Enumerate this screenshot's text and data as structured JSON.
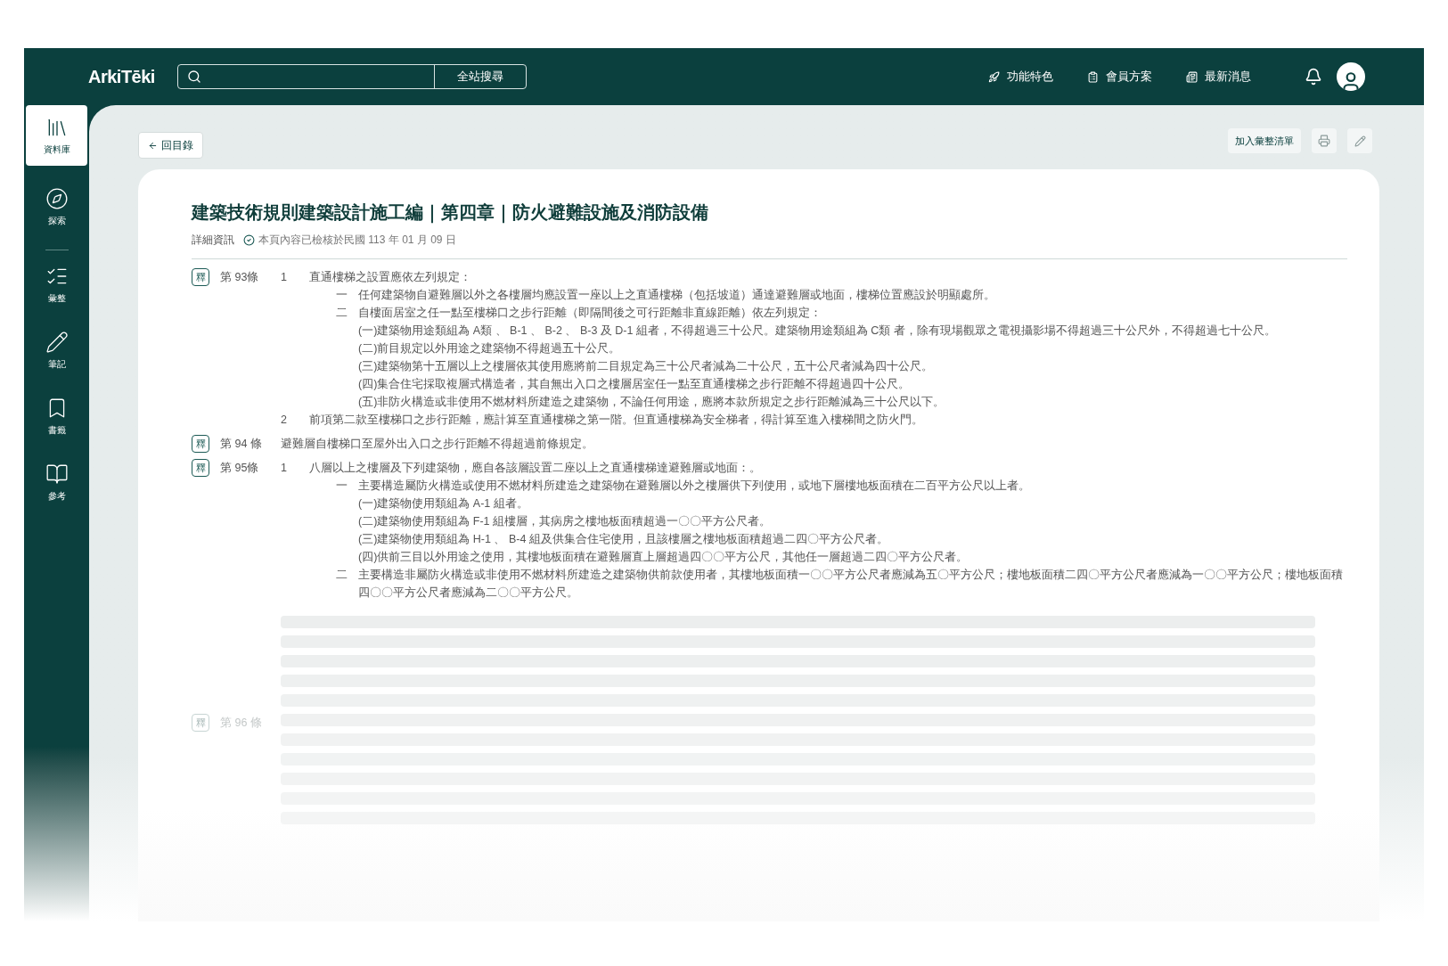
{
  "header": {
    "logo": "ArkiTēki",
    "search": {
      "button": "全站搜尋"
    },
    "nav": [
      "功能特色",
      "會員方案",
      "最新消息"
    ]
  },
  "sidebar": {
    "items": [
      {
        "label": "資料庫",
        "selected": true
      },
      {
        "label": "探索",
        "selected": false
      },
      {
        "label": "彙整",
        "selected": false
      },
      {
        "label": "筆記",
        "selected": false
      },
      {
        "label": "書籤",
        "selected": false
      },
      {
        "label": "參考",
        "selected": false
      }
    ]
  },
  "toolbar": {
    "back": "回目錄",
    "add": "加入彙整清單"
  },
  "document": {
    "title": "建築技術規則建築設計施工編｜第四章｜防火避難設施及消防設備",
    "info_label": "詳細資訊",
    "verified": "本頁內容已檢核於民國 113 年 01 月 09 日",
    "articles": [
      {
        "badge": "釋",
        "number": "第 93條",
        "loading": false,
        "paragraphs": [
          {
            "marker": "1",
            "text": "直通樓梯之設置應依左列規定：",
            "children": [
              {
                "marker": "一",
                "text": "任何建築物自避難層以外之各樓層均應設置一座以上之直通樓梯（包括坡道）通達避難層或地面，樓梯位置應設於明顯處所。"
              },
              {
                "marker": "二",
                "text": "自樓面居室之任一點至樓梯口之步行距離（即隔間後之可行距離非直線距離）依左列規定：",
                "children": [
                  {
                    "text": "(一)建築物用途類組為 A類 、 B-1 、 B-2 、 B-3 及 D-1 組者，不得超過三十公尺。建築物用途類組為 C類 者，除有現場觀眾之電視攝影場不得超過三十公尺外，不得超過七十公尺。"
                  },
                  {
                    "text": "(二)前目規定以外用途之建築物不得超過五十公尺。"
                  },
                  {
                    "text": "(三)建築物第十五層以上之樓層依其使用應將前二目規定為三十公尺者減為二十公尺，五十公尺者減為四十公尺。"
                  },
                  {
                    "text": "(四)集合住宅採取複層式構造者，其自無出入口之樓層居室任一點至直通樓梯之步行距離不得超過四十公尺。"
                  },
                  {
                    "text": "(五)非防火構造或非使用不燃材料所建造之建築物，不論任何用途，應將本款所規定之步行距離減為三十公尺以下。"
                  }
                ]
              }
            ]
          },
          {
            "marker": "2",
            "text": "前項第二款至樓梯口之步行距離，應計算至直通樓梯之第一階。但直通樓梯為安全梯者，得計算至進入樓梯間之防火門。"
          }
        ]
      },
      {
        "badge": "釋",
        "number": "第 94 條",
        "loading": false,
        "text": "避難層自樓梯口至屋外出入口之步行距離不得超過前條規定。"
      },
      {
        "badge": "釋",
        "number": "第 95條",
        "loading": false,
        "paragraphs": [
          {
            "marker": "1",
            "text": "八層以上之樓層及下列建築物，應自各該層設置二座以上之直通樓梯達避難層或地面：。",
            "children": [
              {
                "marker": "一",
                "text": "主要構造屬防火構造或使用不燃材料所建造之建築物在避難層以外之樓層供下列使用，或地下層樓地板面積在二百平方公尺以上者。",
                "children": [
                  {
                    "text": "(一)建築物使用類組為 A-1  組者。"
                  },
                  {
                    "text": "(二)建築物使用類組為 F-1  組樓層，其病房之樓地板面積超過一〇〇平方公尺者。"
                  },
                  {
                    "text": "(三)建築物使用類組為 H-1 、 B-4 組及供集合住宅使用，且該樓層之樓地板面積超過二四〇平方公尺者。"
                  },
                  {
                    "text": "(四)供前三目以外用途之使用，其樓地板面積在避難層直上層超過四〇〇平方公尺，其他任一層超過二四〇平方公尺者。"
                  }
                ]
              },
              {
                "marker": "二",
                "text": "主要構造非屬防火構造或非使用不燃材料所建造之建築物供前款使用者，其樓地板面積一〇〇平方公尺者應減為五〇平方公尺；樓地板面積二四〇平方公尺者應減為一〇〇平方公尺；樓地板面積四〇〇平方公尺者應減為二〇〇平方公尺。"
              }
            ]
          }
        ]
      },
      {
        "badge": "釋",
        "number": "第 96 條",
        "loading": true
      }
    ]
  }
}
